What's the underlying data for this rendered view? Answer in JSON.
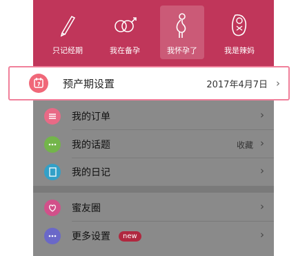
{
  "modes": [
    {
      "label": "只记经期",
      "icon": "pencil-icon",
      "selected": false
    },
    {
      "label": "我在备孕",
      "icon": "gender-rings-icon",
      "selected": false
    },
    {
      "label": "我怀孕了",
      "icon": "pregnant-icon",
      "selected": true
    },
    {
      "label": "我是辣妈",
      "icon": "baby-icon",
      "selected": false
    }
  ],
  "due_date": {
    "title": "预产期设置",
    "value": "2017年4月7日",
    "icon": "calendar-icon"
  },
  "menu": [
    {
      "label": "我的订单",
      "icon": "orders-icon",
      "color": "#e86a86"
    },
    {
      "label": "我的话题",
      "icon": "chat-bubble-icon",
      "color": "#73b54a",
      "right": "收藏"
    },
    {
      "label": "我的日记",
      "icon": "diary-icon",
      "color": "#33a0c7"
    },
    {
      "label": "蜜友圈",
      "icon": "heart-circle-icon",
      "color": "#d2508a"
    },
    {
      "label": "更多设置",
      "icon": "more-dots-icon",
      "color": "#6a68c8",
      "badge": "new"
    }
  ],
  "colors": {
    "accent": "#c0365a",
    "highlight_border": "#f07f9a"
  }
}
